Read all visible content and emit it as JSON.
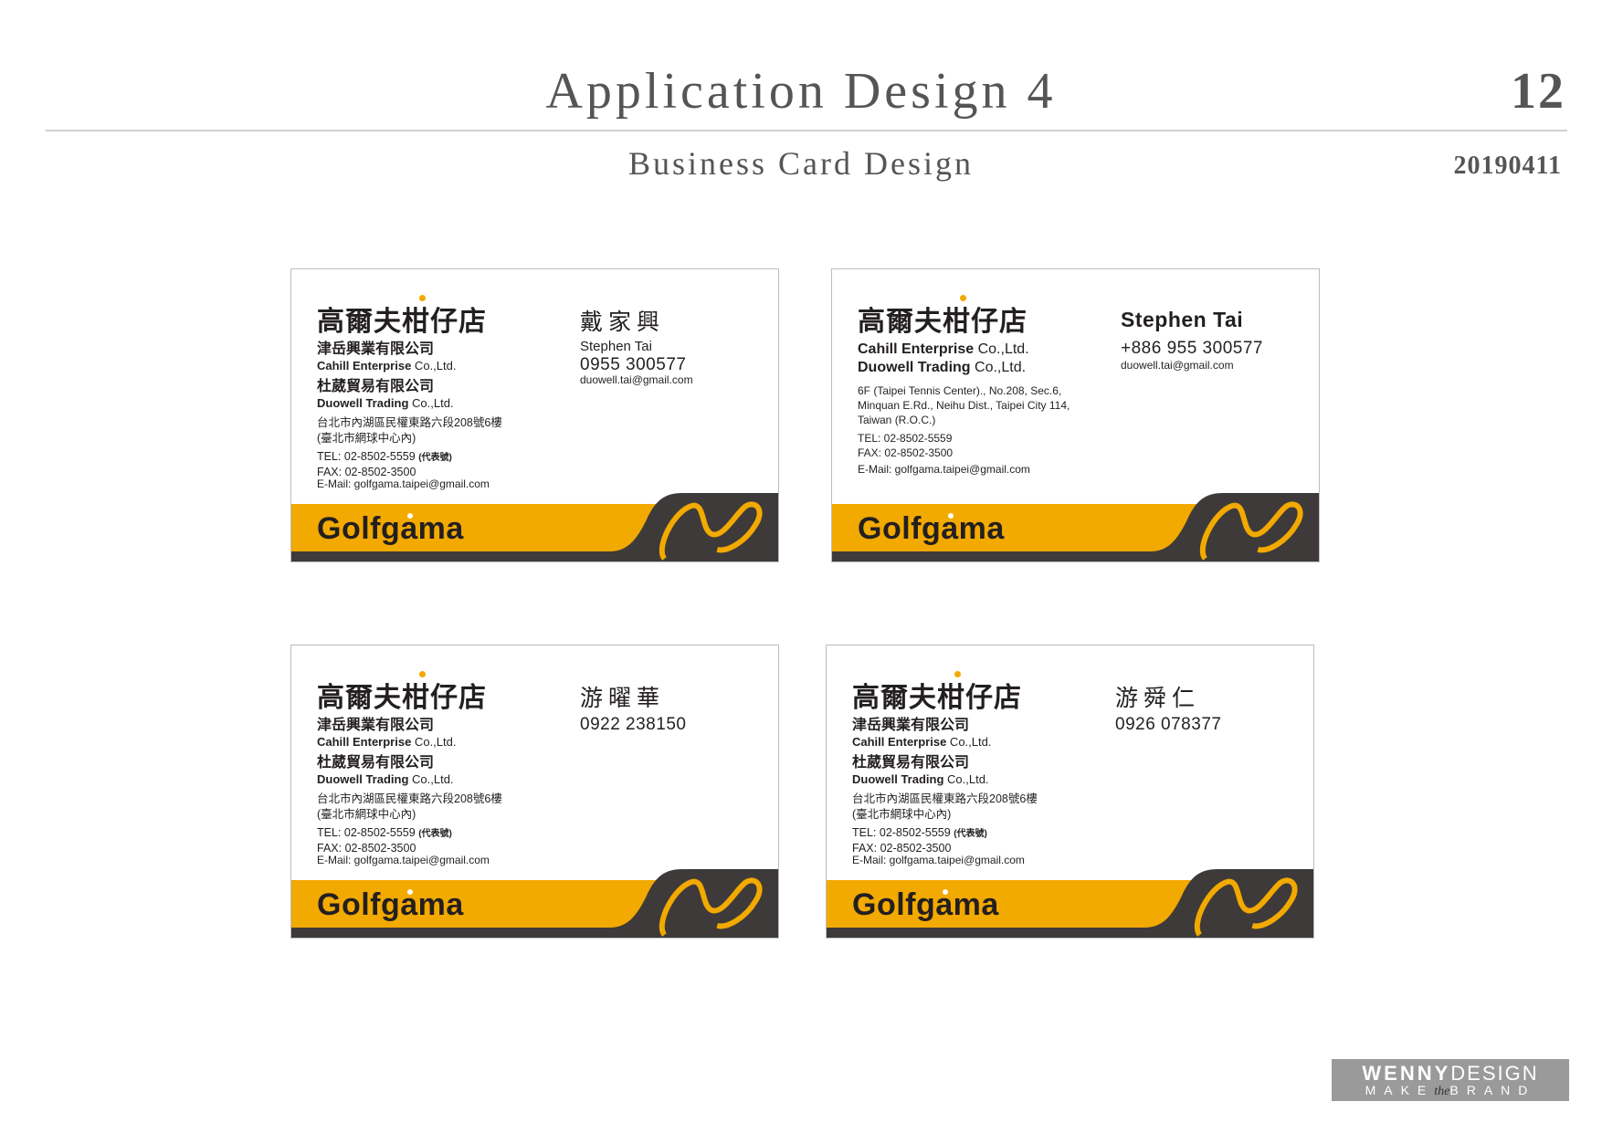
{
  "header": {
    "title": "Application Design 4",
    "page_number": "12",
    "subtitle": "Business Card Design",
    "date": "20190411"
  },
  "colors": {
    "accent_orange": "#f2a900",
    "dark_gray": "#3e3a39",
    "text": "#231f20"
  },
  "shared": {
    "store_name": "高爾夫柑仔店",
    "brand": "Golfgama",
    "company1_zh": "津岳興業有限公司",
    "company1_en_bold": "Cahill Enterprise",
    "company1_en_rest": " Co.,Ltd.",
    "company2_zh": "杜葳貿易有限公司",
    "company2_en_bold": "Duowell Trading",
    "company2_en_rest": " Co.,Ltd.",
    "address1": "台北市內湖區民權東路六段208號6樓",
    "address2": "(臺北市網球中心內)",
    "tel": "TEL: 02-8502-5559",
    "tel_note": "(代表號)",
    "fax": "FAX: 02-8502-3500",
    "email": "E-Mail: golfgama.taipei@gmail.com"
  },
  "card1": {
    "person_name": "戴家興",
    "person_en": "Stephen Tai",
    "phone": "0955 300577",
    "email": "duowell.tai@gmail.com"
  },
  "card2": {
    "person_name": "Stephen Tai",
    "phone": "+886 955 300577",
    "email": "duowell.tai@gmail.com",
    "company1": "Cahill Enterprise",
    "company1_rest": " Co.,Ltd.",
    "company2": "Duowell Trading",
    "company2_rest": " Co.,Ltd.",
    "address_line1": "6F (Taipei Tennis Center)., No.208, Sec.6,",
    "address_line2": "Minquan E.Rd., Neihu Dist., Taipei City 114,",
    "address_line3": "Taiwan (R.O.C.)",
    "tel": "TEL: 02-8502-5559",
    "fax": "FAX: 02-8502-3500",
    "email_line": "E-Mail: golfgama.taipei@gmail.com"
  },
  "card3": {
    "person_name": "游曜華",
    "phone": "0922 238150"
  },
  "card4": {
    "person_name": "游舜仁",
    "phone": "0926 078377"
  },
  "watermark": {
    "line1_bold": "WENNY",
    "line1_rest": "DESIGN",
    "line2_a": "MAKE",
    "line2_the": "the",
    "line2_b": "BRAND"
  }
}
